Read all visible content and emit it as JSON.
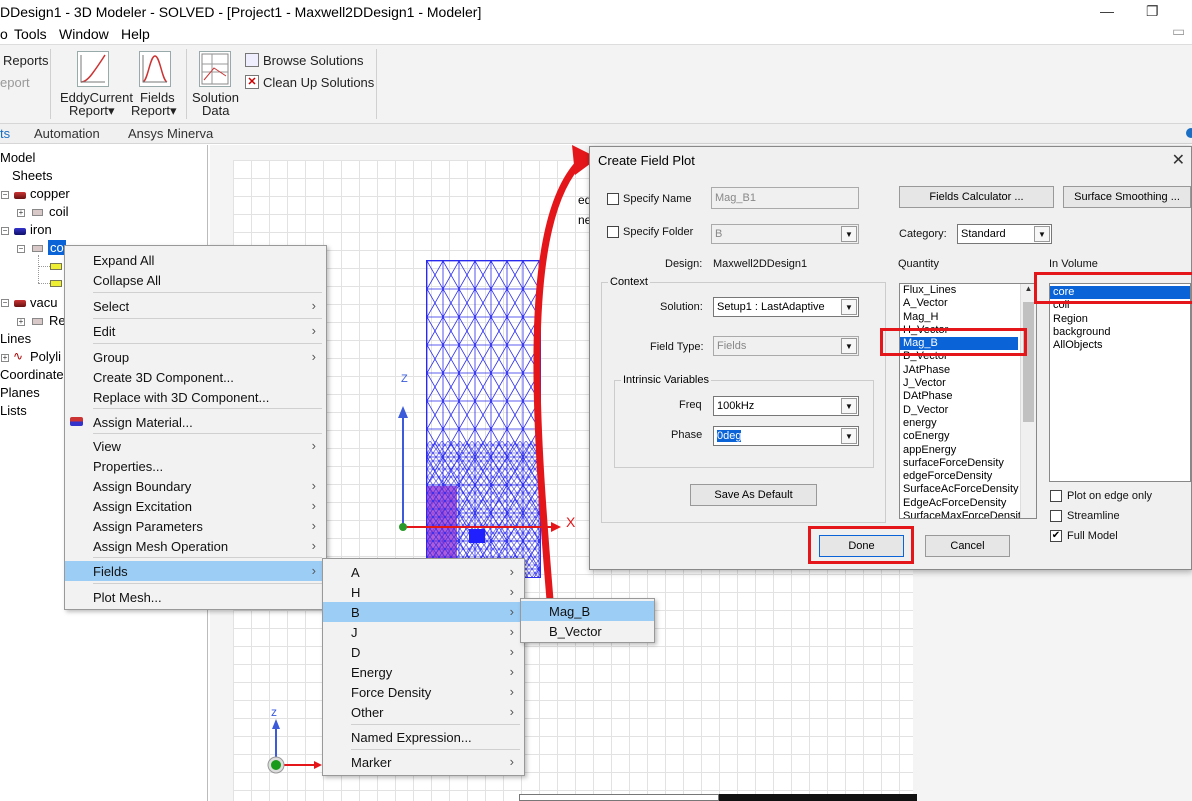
{
  "window": {
    "title": "DDesign1 - 3D Modeler - SOLVED - [Project1 - Maxwell2DDesign1 - Modeler]",
    "minimize": "—",
    "restore": "❐"
  },
  "menubar": [
    "o",
    "Tools",
    "Window",
    "Help"
  ],
  "ribbon": {
    "reports_label": "Reports",
    "report_label": "eport",
    "eddy_line1": "EddyCurrent",
    "eddy_line2": "Report▾",
    "fields_line1": "Fields",
    "fields_line2": "Report▾",
    "solution_line1": "Solution",
    "solution_line2": "Data",
    "browse_solutions": "Browse Solutions",
    "clean_up_solutions": "Clean Up Solutions"
  },
  "tabs": [
    "ts",
    "Automation",
    "Ansys Minerva"
  ],
  "tree": {
    "model": "Model",
    "sheets": "Sheets",
    "copper": "copper",
    "coil": "coil",
    "iron": "iron",
    "core_partial": "co",
    "vacuum_partial": "vacu",
    "region_partial": "Re",
    "lines": "Lines",
    "polyline_partial": "Polyli",
    "coordinate_partial": "Coordinate",
    "planes_partial": "Planes",
    "lists_partial": "Lists"
  },
  "viewport": {
    "axis_x": "X",
    "axis_z": "Z",
    "triad_z": "z",
    "partial_text_1": "ed",
    "partial_text_2": "ne"
  },
  "context_menu": {
    "items": [
      {
        "label": "Expand All",
        "arrow": ""
      },
      {
        "label": "Collapse All",
        "arrow": ""
      },
      {
        "label": "Select",
        "arrow": "›"
      },
      {
        "label": "Edit",
        "arrow": "›"
      },
      {
        "label": "Group",
        "arrow": "›"
      },
      {
        "label": "Create 3D Component...",
        "arrow": ""
      },
      {
        "label": "Replace with 3D Component...",
        "arrow": ""
      },
      {
        "label": "Assign Material...",
        "arrow": ""
      },
      {
        "label": "View",
        "arrow": "›"
      },
      {
        "label": "Properties...",
        "arrow": ""
      },
      {
        "label": "Assign Boundary",
        "arrow": "›"
      },
      {
        "label": "Assign Excitation",
        "arrow": "›"
      },
      {
        "label": "Assign Parameters",
        "arrow": "›"
      },
      {
        "label": "Assign Mesh Operation",
        "arrow": "›"
      },
      {
        "label": "Fields",
        "arrow": "›"
      },
      {
        "label": "Plot Mesh...",
        "arrow": ""
      }
    ]
  },
  "fields_submenu": {
    "items": [
      {
        "label": "A",
        "arrow": "›"
      },
      {
        "label": "H",
        "arrow": "›"
      },
      {
        "label": "B",
        "arrow": "›"
      },
      {
        "label": "J",
        "arrow": "›"
      },
      {
        "label": "D",
        "arrow": "›"
      },
      {
        "label": "Energy",
        "arrow": "›"
      },
      {
        "label": "Force Density",
        "arrow": "›"
      },
      {
        "label": "Other",
        "arrow": "›"
      },
      {
        "label": "Named Expression...",
        "arrow": ""
      },
      {
        "label": "Marker",
        "arrow": "›"
      }
    ]
  },
  "b_submenu": {
    "items": [
      {
        "label": "Mag_B"
      },
      {
        "label": "B_Vector"
      }
    ]
  },
  "dialog": {
    "title": "Create Field Plot",
    "close": "✕",
    "specify_name_label": "Specify Name",
    "specify_name_value": "Mag_B1",
    "specify_folder_label": "Specify Folder",
    "specify_folder_value": "B",
    "design_label": "Design:",
    "design_value": "Maxwell2DDesign1",
    "context_label": "Context",
    "solution_label": "Solution:",
    "solution_value": "Setup1 : LastAdaptive",
    "field_type_label": "Field Type:",
    "field_type_value": "Fields",
    "intrinsic_label": "Intrinsic Variables",
    "freq_label": "Freq",
    "freq_value": "100kHz",
    "phase_label": "Phase",
    "phase_value": "0deg",
    "save_as_default": "Save As Default",
    "fields_calculator": "Fields Calculator ...",
    "surface_smoothing": "Surface Smoothing ...",
    "category_label": "Category:",
    "category_value": "Standard",
    "quantity_label": "Quantity",
    "quantity_items": [
      "Flux_Lines",
      "A_Vector",
      "Mag_H",
      "H_Vector",
      "Mag_B",
      "B_Vector",
      "JAtPhase",
      "J_Vector",
      "DAtPhase",
      "D_Vector",
      "energy",
      "coEnergy",
      "appEnergy",
      "surfaceForceDensity",
      "edgeForceDensity",
      "SurfaceAcForceDensity",
      "EdgeAcForceDensity",
      "SurfaceMaxForceDensit"
    ],
    "quantity_selected": "Mag_B",
    "in_volume_label": "In Volume",
    "volume_items": [
      "core",
      "coil",
      "Region",
      "background",
      "AllObjects"
    ],
    "volume_selected": "core",
    "plot_on_edge_only": "Plot on edge only",
    "streamline": "Streamline",
    "full_model": "Full Model",
    "full_model_checked": "✔",
    "done": "Done",
    "cancel": "Cancel"
  },
  "colors": {
    "highlight": "#9ccdf5",
    "selection": "#0a64d8",
    "annotation_red": "#e4161a",
    "mesh_blue": "#2a2aee"
  }
}
